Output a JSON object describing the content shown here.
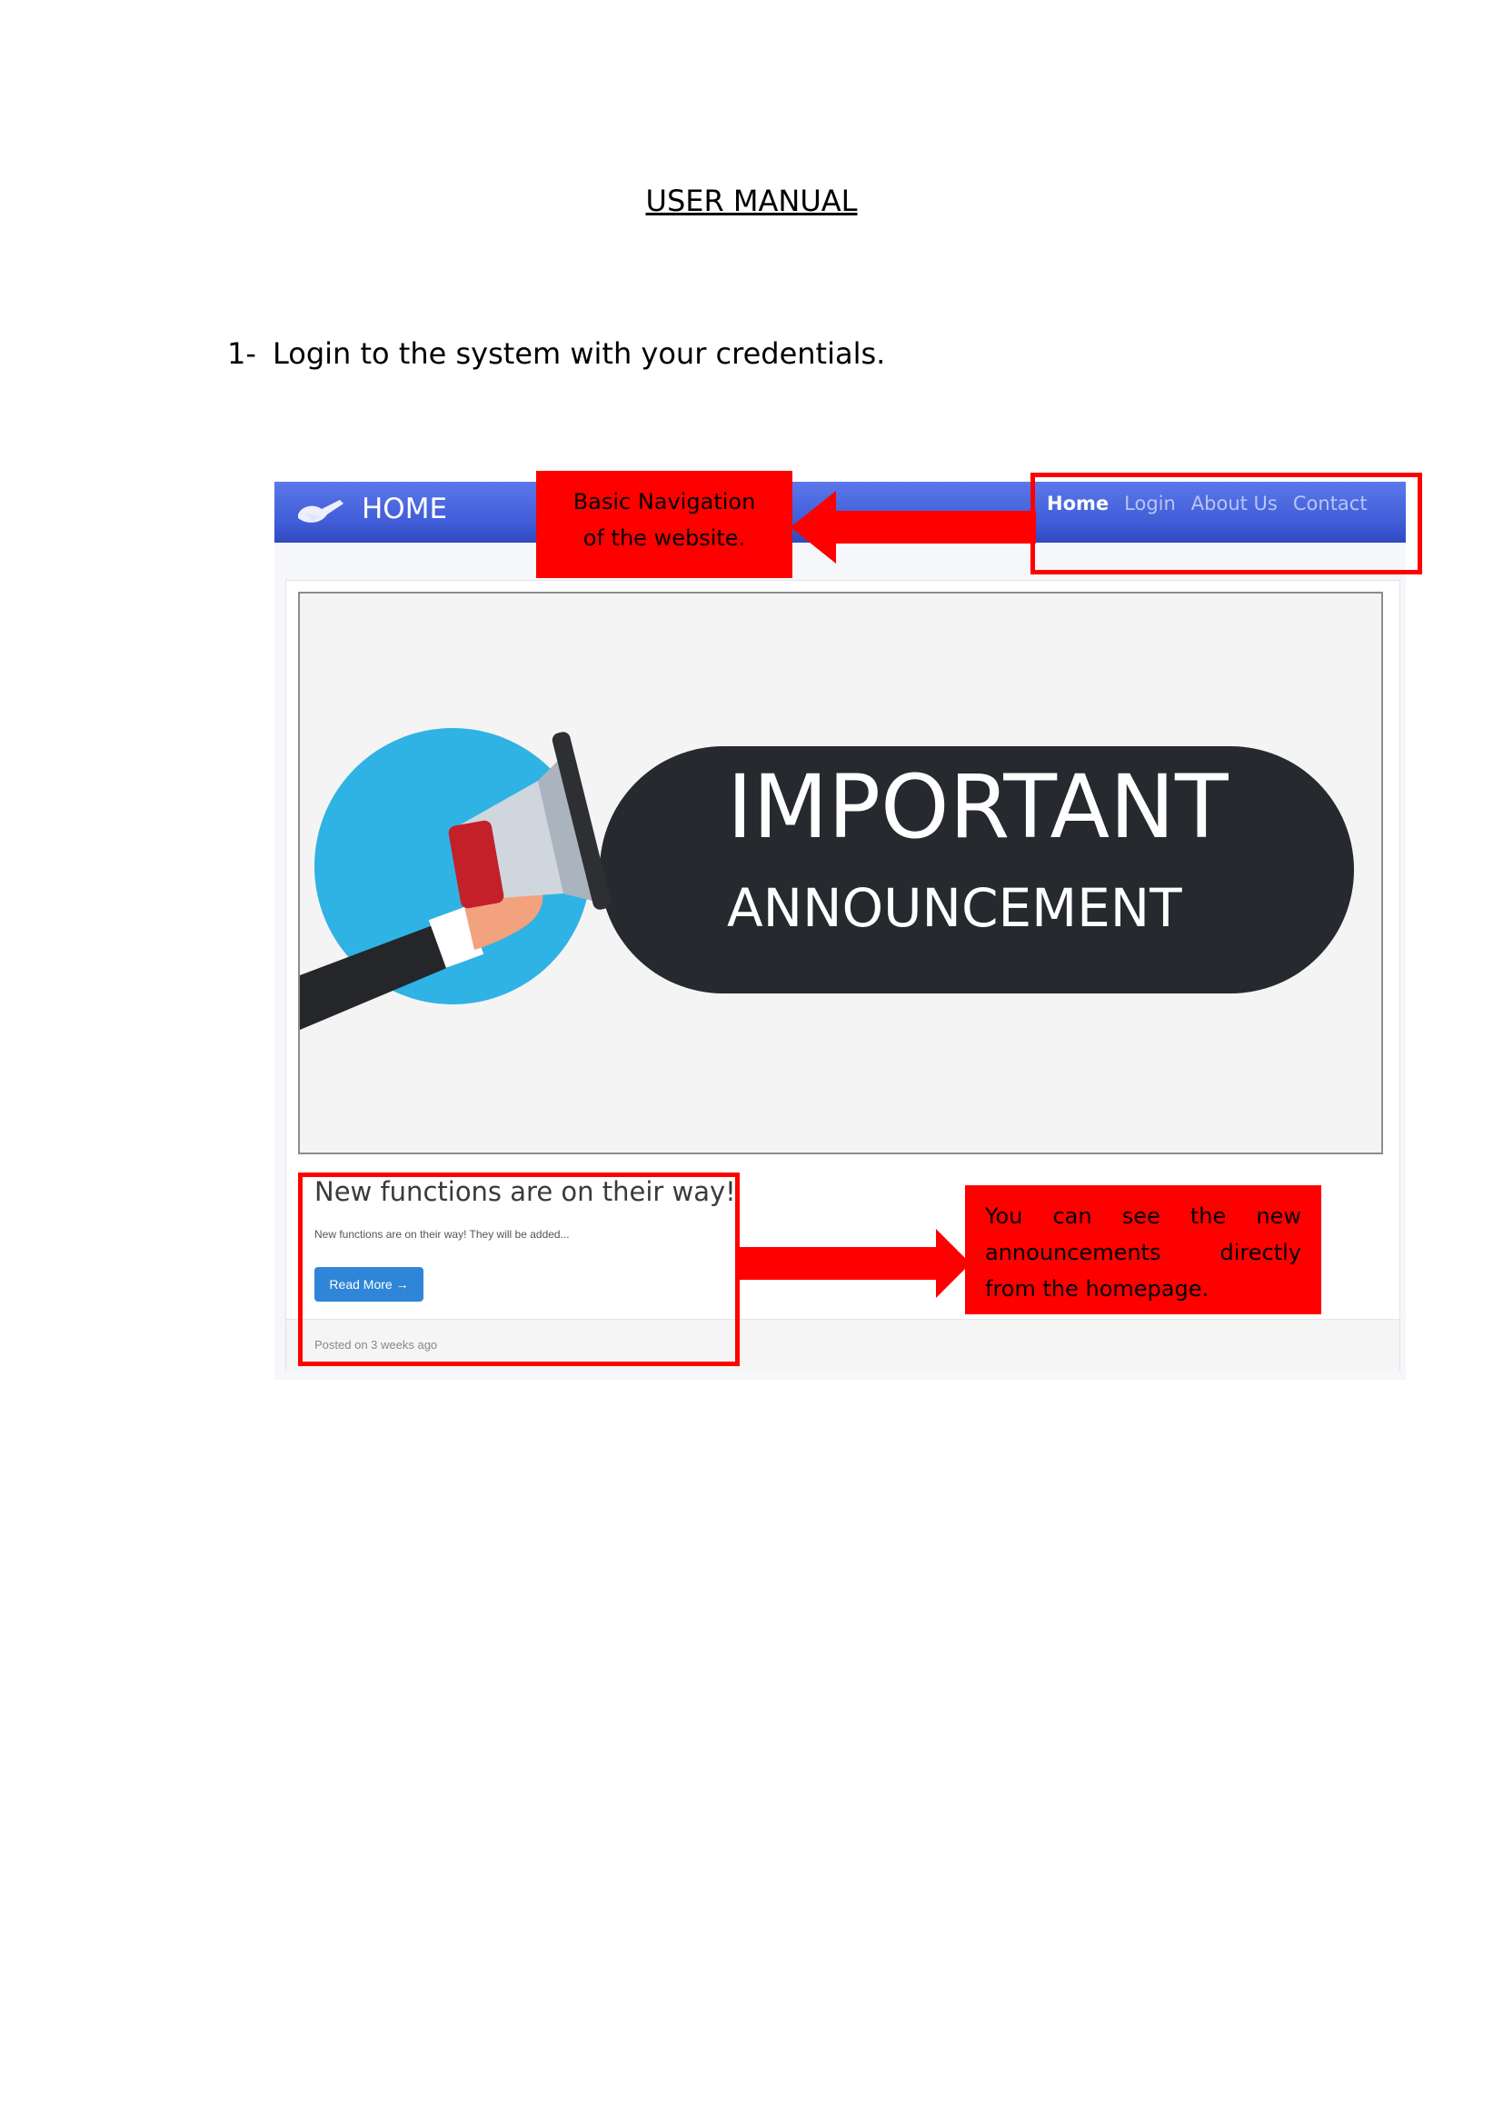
{
  "document": {
    "title": "USER MANUAL",
    "step": {
      "number": "1-",
      "text": "Login to the system with your credentials."
    }
  },
  "screenshot": {
    "navbar": {
      "brand": "HOME",
      "links": [
        {
          "label": "Home",
          "active": true
        },
        {
          "label": "Login",
          "active": false
        },
        {
          "label": "About Us",
          "active": false
        },
        {
          "label": "Contact",
          "active": false
        }
      ],
      "color": "#4362dc"
    },
    "hero": {
      "line1": "IMPORTANT",
      "line2": "ANNOUNCEMENT"
    },
    "post": {
      "title": "New functions are on their way!",
      "excerpt": "New functions are on their way! They will be added...",
      "button": "Read More →",
      "posted": "Posted on 3 weeks ago"
    }
  },
  "annotations": {
    "nav_callout": [
      "Basic Navigation",
      "of the website."
    ],
    "announcement_callout": [
      "You can see the new",
      "announcements directly",
      "from the homepage."
    ],
    "highlight_color": "#ff0000"
  }
}
